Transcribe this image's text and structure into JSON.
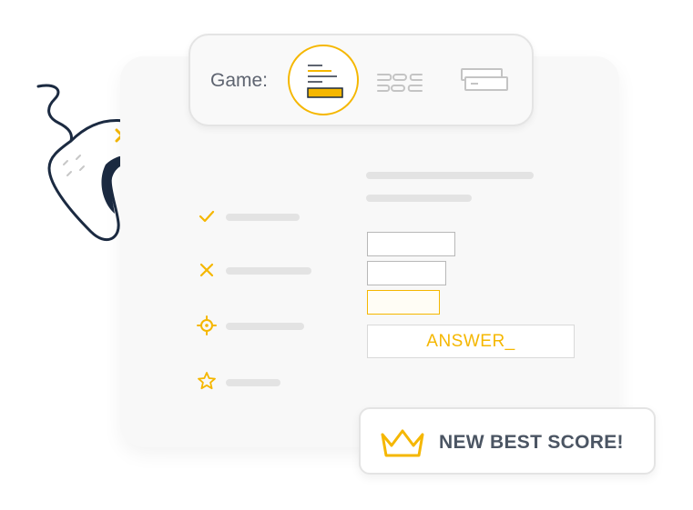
{
  "toolbar": {
    "label": "Game:",
    "modes": [
      {
        "icon": "text-lines-icon",
        "active": true
      },
      {
        "icon": "word-blocks-icon",
        "active": false
      },
      {
        "icon": "card-stack-icon",
        "active": false
      }
    ]
  },
  "feedback_rows": [
    {
      "icon": "check-icon"
    },
    {
      "icon": "cross-icon"
    },
    {
      "icon": "target-icon"
    },
    {
      "icon": "star-icon"
    }
  ],
  "answer": {
    "text": "ANSWER_"
  },
  "badge": {
    "text": "NEW BEST SCORE!",
    "icon": "crown-icon"
  },
  "colors": {
    "accent": "#f5b700",
    "text": "#4b5563",
    "outline": "#1b2a41",
    "skeleton": "#e3e3e3"
  }
}
